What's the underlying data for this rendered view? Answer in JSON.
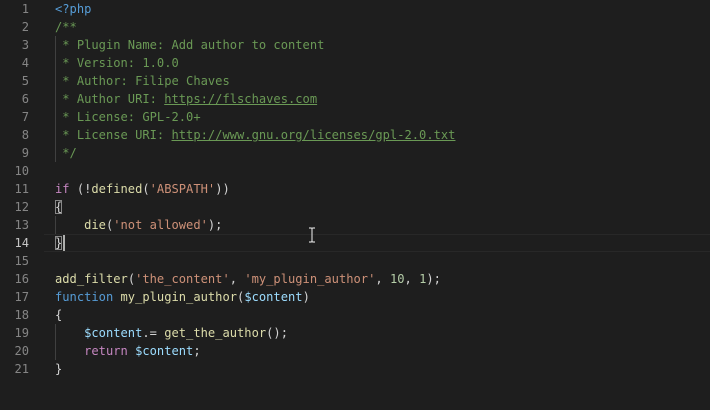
{
  "editor": {
    "language": "php",
    "active_line": 14,
    "lines": [
      {
        "n": "1",
        "tokens": [
          {
            "t": "<?php",
            "c": "tag"
          }
        ]
      },
      {
        "n": "2",
        "tokens": [
          {
            "t": "/**",
            "c": "com"
          }
        ]
      },
      {
        "n": "3",
        "tokens": [
          {
            "t": " * Plugin Name: Add author to content",
            "c": "com"
          }
        ]
      },
      {
        "n": "4",
        "tokens": [
          {
            "t": " * Version: 1.0.0",
            "c": "com"
          }
        ]
      },
      {
        "n": "5",
        "tokens": [
          {
            "t": " * Author: Filipe Chaves",
            "c": "com"
          }
        ]
      },
      {
        "n": "6",
        "tokens": [
          {
            "t": " * Author URI: ",
            "c": "com"
          },
          {
            "t": "https://flschaves.com",
            "c": "link"
          }
        ]
      },
      {
        "n": "7",
        "tokens": [
          {
            "t": " * License: GPL-2.0+",
            "c": "com"
          }
        ]
      },
      {
        "n": "8",
        "tokens": [
          {
            "t": " * License URI: ",
            "c": "com"
          },
          {
            "t": "http://www.gnu.org/licenses/gpl-2.0.txt",
            "c": "link"
          }
        ]
      },
      {
        "n": "9",
        "tokens": [
          {
            "t": " */",
            "c": "com"
          }
        ]
      },
      {
        "n": "10",
        "tokens": []
      },
      {
        "n": "11",
        "tokens": [
          {
            "t": "if",
            "c": "ctrl"
          },
          {
            "t": " (!",
            "c": "pl"
          },
          {
            "t": "defined",
            "c": "fn"
          },
          {
            "t": "(",
            "c": "pl"
          },
          {
            "t": "'ABSPATH'",
            "c": "str"
          },
          {
            "t": "))",
            "c": "pl"
          }
        ]
      },
      {
        "n": "12",
        "tokens": [
          {
            "t": "{",
            "c": "pl",
            "m": "bracket-open"
          }
        ]
      },
      {
        "n": "13",
        "tokens": [
          {
            "t": "    ",
            "c": "pl"
          },
          {
            "t": "die",
            "c": "fn"
          },
          {
            "t": "(",
            "c": "pl"
          },
          {
            "t": "'not allowed'",
            "c": "str"
          },
          {
            "t": ");",
            "c": "pl"
          }
        ]
      },
      {
        "n": "14",
        "tokens": [
          {
            "t": "}",
            "c": "pl",
            "m": "bracket-close"
          }
        ]
      },
      {
        "n": "15",
        "tokens": []
      },
      {
        "n": "16",
        "tokens": [
          {
            "t": "add_filter",
            "c": "fn"
          },
          {
            "t": "(",
            "c": "pl"
          },
          {
            "t": "'the_content'",
            "c": "str"
          },
          {
            "t": ", ",
            "c": "pl"
          },
          {
            "t": "'my_plugin_author'",
            "c": "str"
          },
          {
            "t": ", ",
            "c": "pl"
          },
          {
            "t": "10",
            "c": "num"
          },
          {
            "t": ", ",
            "c": "pl"
          },
          {
            "t": "1",
            "c": "num"
          },
          {
            "t": ");",
            "c": "pl"
          }
        ]
      },
      {
        "n": "17",
        "tokens": [
          {
            "t": "function",
            "c": "kw"
          },
          {
            "t": " ",
            "c": "pl"
          },
          {
            "t": "my_plugin_author",
            "c": "fn"
          },
          {
            "t": "(",
            "c": "pl"
          },
          {
            "t": "$content",
            "c": "var"
          },
          {
            "t": ")",
            "c": "pl"
          }
        ]
      },
      {
        "n": "18",
        "tokens": [
          {
            "t": "{",
            "c": "pl"
          }
        ]
      },
      {
        "n": "19",
        "tokens": [
          {
            "t": "    ",
            "c": "pl"
          },
          {
            "t": "$content",
            "c": "var"
          },
          {
            "t": ".= ",
            "c": "pl"
          },
          {
            "t": "get_the_author",
            "c": "fn"
          },
          {
            "t": "();",
            "c": "pl"
          }
        ]
      },
      {
        "n": "20",
        "tokens": [
          {
            "t": "    ",
            "c": "pl"
          },
          {
            "t": "return",
            "c": "ctrl"
          },
          {
            "t": " ",
            "c": "pl"
          },
          {
            "t": "$content",
            "c": "var"
          },
          {
            "t": ";",
            "c": "pl"
          }
        ]
      },
      {
        "n": "21",
        "tokens": [
          {
            "t": "}",
            "c": "pl"
          }
        ]
      }
    ]
  },
  "colors": {
    "background": "#1e1e1e",
    "line_number": "#858585",
    "line_number_active": "#c6c6c6",
    "comment": "#6a9955",
    "string": "#ce9178",
    "function": "#dcdcaa",
    "keyword": "#569cd6",
    "control": "#c586c0",
    "variable": "#9cdcfe",
    "number": "#b5cea8"
  },
  "icons": {
    "mouse_cursor": "text-ibeam-icon"
  }
}
